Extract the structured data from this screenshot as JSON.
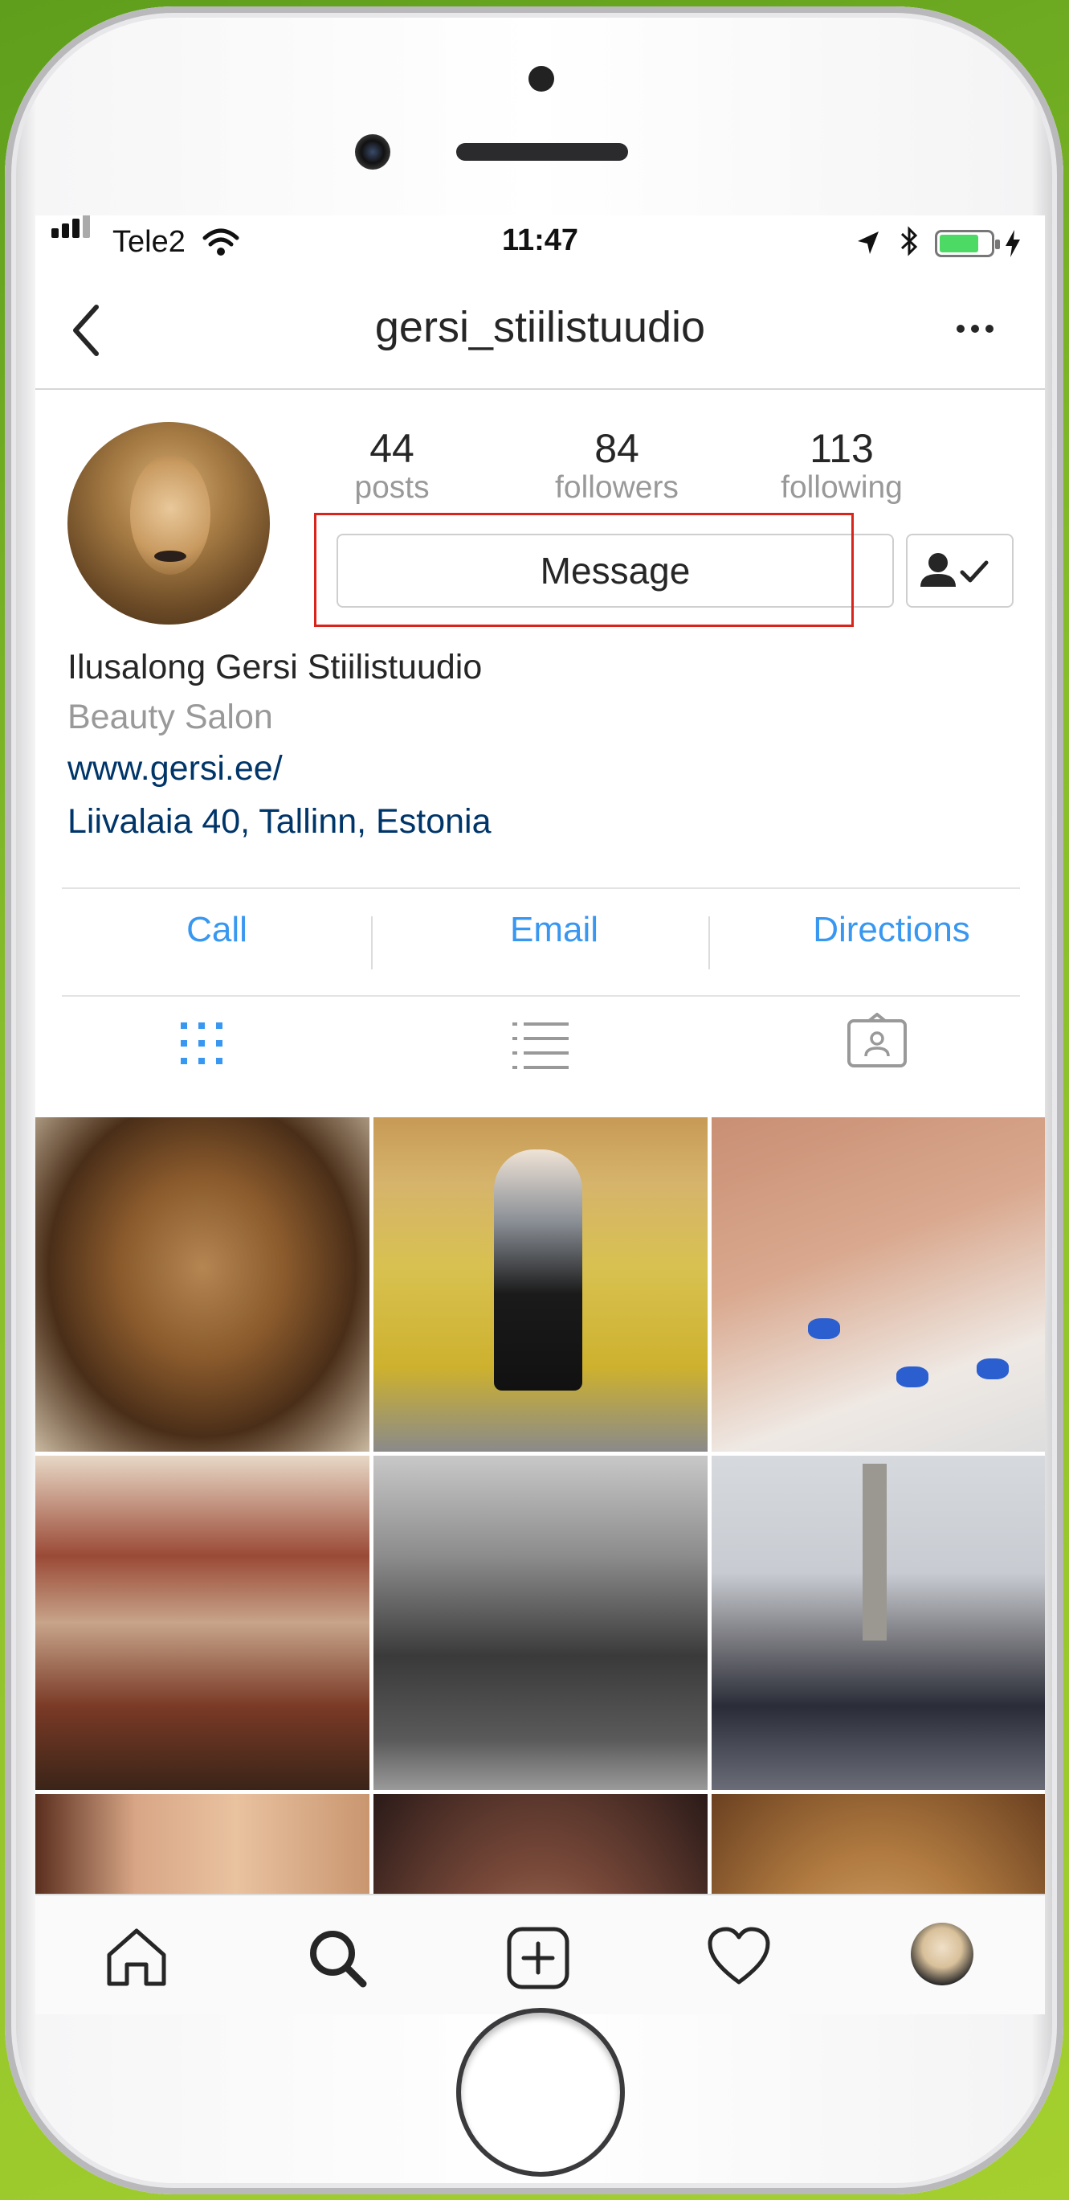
{
  "status_bar": {
    "carrier": "Tele2",
    "time": "11:47"
  },
  "nav": {
    "title": "gersi_stiilistuudio"
  },
  "profile": {
    "stats": [
      {
        "value": "44",
        "label": "posts"
      },
      {
        "value": "84",
        "label": "followers"
      },
      {
        "value": "113",
        "label": "following"
      }
    ],
    "message_label": "Message",
    "name": "Ilusalong Gersi Stiilistuudio",
    "category": "Beauty Salon",
    "website": "www.gersi.ee/",
    "address": "Liivalaia 40, Tallinn, Estonia"
  },
  "actions": [
    "Call",
    "Email",
    "Directions"
  ],
  "colors": {
    "link": "#3897f0",
    "dark_link": "#003569",
    "highlight_box": "#d9241c",
    "battery": "#4cd964"
  },
  "icons": {
    "tabs": [
      "grid-icon",
      "list-icon",
      "tagged-icon"
    ],
    "tabbar": [
      "home-icon",
      "search-icon",
      "add-post-icon",
      "heart-icon",
      "profile-avatar"
    ]
  }
}
